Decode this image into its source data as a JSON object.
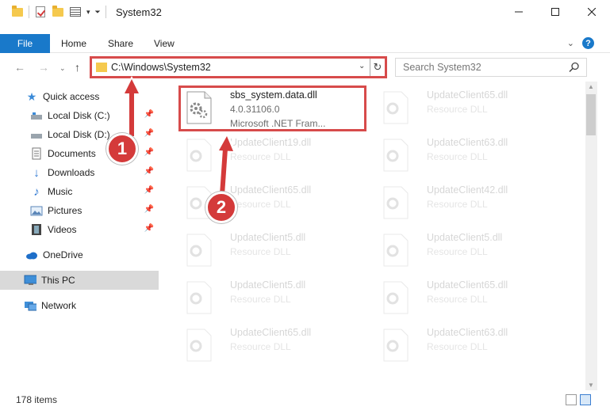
{
  "window": {
    "title": "System32",
    "minimize_icon": "minimize-icon",
    "maximize_icon": "maximize-icon",
    "close_icon": "close-icon"
  },
  "ribbon": {
    "file_tab": "File",
    "tabs": [
      "Home",
      "Share",
      "View"
    ]
  },
  "address": {
    "path": "C:\\Windows\\System32",
    "search_placeholder": "Search System32"
  },
  "sidebar": {
    "items": [
      {
        "label": "Quick access",
        "icon": "star-icon"
      },
      {
        "label": "Local Disk (C:)",
        "icon": "drive-icon",
        "pinned": true
      },
      {
        "label": "Local Disk (D:)",
        "icon": "drive-icon",
        "pinned": true
      },
      {
        "label": "Documents",
        "icon": "documents-icon",
        "pinned": true
      },
      {
        "label": "Downloads",
        "icon": "download-icon",
        "pinned": true
      },
      {
        "label": "Music",
        "icon": "music-icon",
        "pinned": true
      },
      {
        "label": "Pictures",
        "icon": "pictures-icon",
        "pinned": true
      },
      {
        "label": "Videos",
        "icon": "videos-icon",
        "pinned": true
      },
      {
        "label": "OneDrive",
        "icon": "cloud-icon"
      },
      {
        "label": "This PC",
        "icon": "computer-icon",
        "selected": true
      },
      {
        "label": "Network",
        "icon": "network-icon"
      }
    ]
  },
  "files": {
    "highlighted": {
      "name": "sbs_system.data.dll",
      "version": "4.0.31106.0",
      "company": "Microsoft .NET Fram..."
    },
    "left": [
      {
        "name": "UpdateClient19.dll",
        "type": "Resource DLL"
      },
      {
        "name": "UpdateClient65.dll",
        "type": "Resource DLL"
      },
      {
        "name": "UpdateClient5.dll",
        "type": "Resource DLL"
      },
      {
        "name": "UpdateClient5.dll",
        "type": "Resource DLL"
      },
      {
        "name": "UpdateClient65.dll",
        "type": "Resource DLL"
      }
    ],
    "right": [
      {
        "name": "UpdateClient65.dll",
        "type": "Resource DLL"
      },
      {
        "name": "UpdateClient63.dll",
        "type": "Resource DLL"
      },
      {
        "name": "UpdateClient42.dll",
        "type": "Resource DLL"
      },
      {
        "name": "UpdateClient5.dll",
        "type": "Resource DLL"
      },
      {
        "name": "UpdateClient65.dll",
        "type": "Resource DLL"
      },
      {
        "name": "UpdateClient63.dll",
        "type": "Resource DLL"
      }
    ]
  },
  "status": {
    "item_count": "178 items"
  },
  "callouts": [
    "1",
    "2"
  ],
  "colors": {
    "accent": "#1979ca",
    "highlight_red": "#d74b4b",
    "selected_bg": "#d9d9d9"
  }
}
